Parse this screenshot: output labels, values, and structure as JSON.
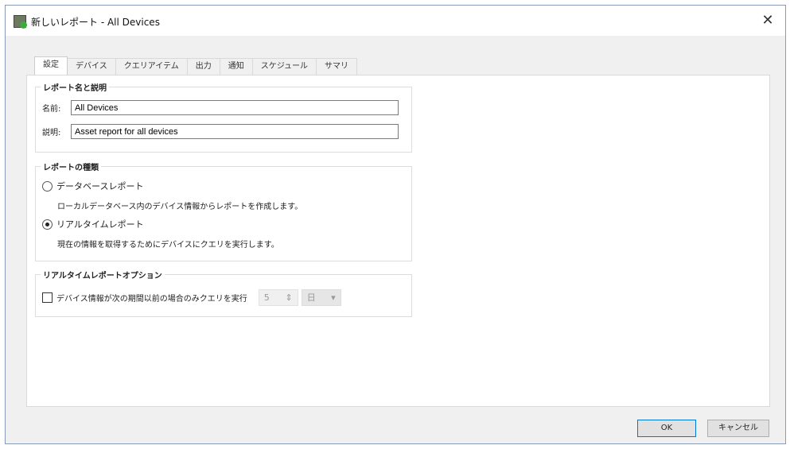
{
  "window": {
    "title": "新しいレポート - All Devices"
  },
  "tabs": [
    "設定",
    "デバイス",
    "クエリアイテム",
    "出力",
    "通知",
    "スケジュール",
    "サマリ"
  ],
  "name_group": {
    "title": "レポート名と説明",
    "name_label": "名前:",
    "name_value": "All Devices",
    "desc_label": "説明:",
    "desc_value": "Asset report for all devices"
  },
  "type_group": {
    "title": "レポートの種類",
    "database": {
      "label": "データベースレポート",
      "description": "ローカルデータベース内のデバイス情報からレポートを作成します。",
      "selected": false
    },
    "realtime": {
      "label": "リアルタイムレポート",
      "description": "現在の情報を取得するためにデバイスにクエリを実行します。",
      "selected": true
    }
  },
  "options_group": {
    "title": "リアルタイムレポートオプション",
    "checkbox_label": "デバイス情報が次の期間以前の場合のみクエリを実行",
    "checked": false,
    "period_value": "5",
    "period_unit": "日",
    "spin_arrows": "⇕",
    "dropdown_arrow": "▾"
  },
  "buttons": {
    "ok": "OK",
    "cancel": "キャンセル"
  },
  "close_glyph": "✕"
}
